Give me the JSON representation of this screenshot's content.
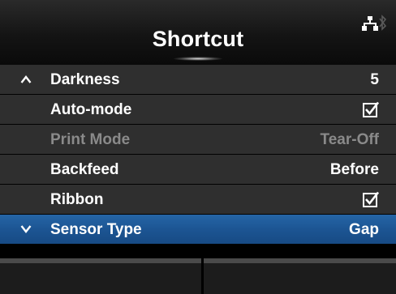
{
  "header": {
    "title": "Shortcut",
    "icons": [
      "network-icon",
      "bluetooth-icon"
    ]
  },
  "menu": {
    "items": [
      {
        "label": "Darkness",
        "value": "5",
        "arrow": "up",
        "enabled": true
      },
      {
        "label": "Auto-mode",
        "value_type": "checkbox",
        "checked": true,
        "enabled": true
      },
      {
        "label": "Print Mode",
        "value": "Tear-Off",
        "enabled": false
      },
      {
        "label": "Backfeed",
        "value": "Before",
        "enabled": true
      },
      {
        "label": "Ribbon",
        "value_type": "checkbox",
        "checked": true,
        "enabled": true
      },
      {
        "label": "Sensor Type",
        "value": "Gap",
        "arrow": "down",
        "selected": true,
        "enabled": true
      }
    ]
  },
  "softkeys": {
    "left_label": "",
    "right_label": ""
  },
  "colors": {
    "row_background": "#2f2f2f",
    "selected_row": "#1c5593",
    "disabled_text": "#8a8a8a",
    "text": "#ffffff",
    "background": "#000000"
  }
}
